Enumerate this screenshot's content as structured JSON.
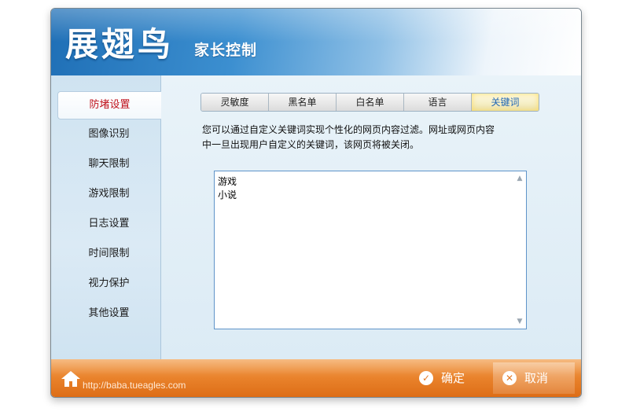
{
  "header": {
    "logo": "展翅鸟",
    "subtitle": "家长控制"
  },
  "sidebar": {
    "items": [
      {
        "label": "防堵设置",
        "active": true
      },
      {
        "label": "图像识别"
      },
      {
        "label": "聊天限制"
      },
      {
        "label": "游戏限制"
      },
      {
        "label": "日志设置"
      },
      {
        "label": "时间限制"
      },
      {
        "label": "视力保护"
      },
      {
        "label": "其他设置"
      }
    ]
  },
  "tabs": [
    {
      "label": "灵敏度"
    },
    {
      "label": "黑名单"
    },
    {
      "label": "白名单"
    },
    {
      "label": "语言"
    },
    {
      "label": "关键词",
      "active": true
    }
  ],
  "description": {
    "line1": "您可以通过自定义关键词实现个性化的网页内容过滤。网址或网页内容",
    "line2": "中一旦出现用户自定义的关键词，该网页将被关闭。"
  },
  "keywords": [
    "游戏",
    "小说"
  ],
  "footer": {
    "home_icon": "home-icon",
    "url": "http://baba.tueagles.com",
    "ok_label": "确定",
    "ok_icon": "check-icon",
    "cancel_label": "取消",
    "cancel_icon": "close-icon"
  },
  "colors": {
    "header_blue": "#1f6fb6",
    "footer_orange": "#e9822b",
    "active_red": "#c0121c",
    "active_tab_blue": "#2268b5"
  }
}
